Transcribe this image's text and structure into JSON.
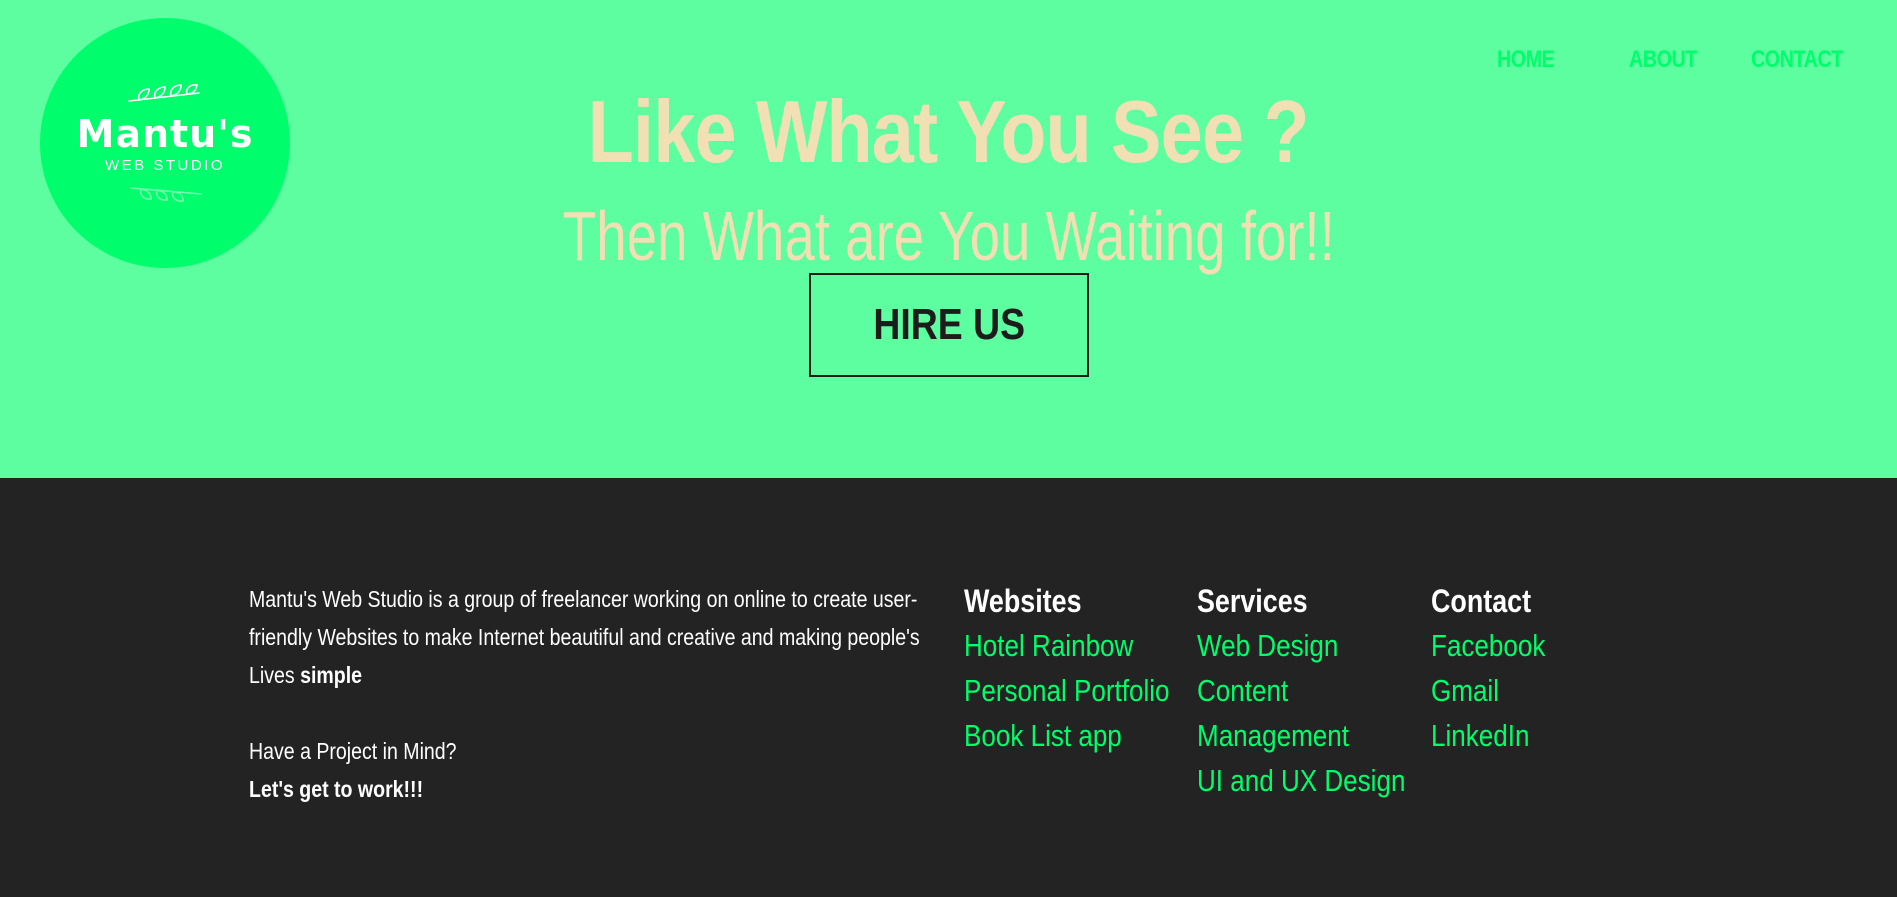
{
  "logo": {
    "name": "Mantu's",
    "subtitle": "WEB STUDIO"
  },
  "nav": {
    "items": [
      {
        "label": "HOME"
      },
      {
        "label": "ABOUT"
      },
      {
        "label": "CONTACT"
      }
    ]
  },
  "hero": {
    "headline": "Like What You See ?",
    "subheadline": "Then What are You Waiting for!!",
    "cta_label": "HIRE US"
  },
  "footer": {
    "about": {
      "text_lead": "Mantu's Web Studio is a group of freelancer working on online to create user-friendly Websites to make Internet beautiful and creative and making people's Lives ",
      "text_bold": "simple",
      "project_question": "Have a Project in Mind?",
      "project_cta": "Let's get to work!!!"
    },
    "columns": [
      {
        "heading": "Websites",
        "links": [
          "Hotel Rainbow",
          "Personal Portfolio",
          "Book List app"
        ]
      },
      {
        "heading": "Services",
        "links": [
          "Web Design",
          "Content",
          "Management",
          "UI and UX Design"
        ]
      },
      {
        "heading": "Contact",
        "links": [
          "Facebook",
          "Gmail",
          "LinkedIn"
        ]
      }
    ]
  },
  "colors": {
    "hero_bg": "#5dfea0",
    "accent_green": "#00fe6c",
    "cream": "#f2e0b5",
    "footer_bg": "#232323",
    "dark_text": "#1c1c1c"
  }
}
